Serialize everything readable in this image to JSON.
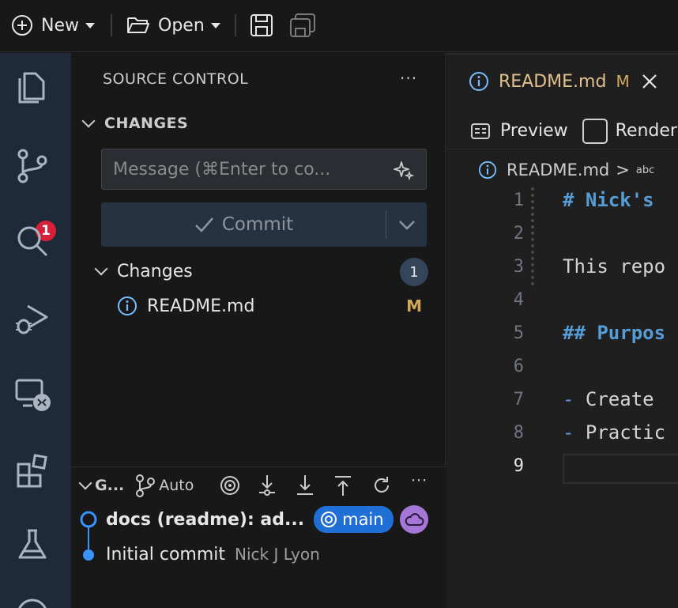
{
  "toolbar": {
    "new_label": "New",
    "open_label": "Open"
  },
  "activity": {
    "scm_badge": "1"
  },
  "sidebar": {
    "title": "SOURCE CONTROL",
    "more": "···",
    "section": "CHANGES",
    "message_placeholder": "Message (⌘Enter to co...",
    "commit_label": "Commit",
    "changes_group": "Changes",
    "changes_count": "1",
    "files": [
      {
        "name": "README.md",
        "status": "M"
      }
    ]
  },
  "graph": {
    "title": "G...",
    "auto_label": "Auto",
    "more": "···",
    "commits": [
      {
        "message": "docs (readme): ad...",
        "branch": "main"
      },
      {
        "message": "Initial commit",
        "author": "Nick J Lyon"
      }
    ]
  },
  "editor": {
    "tab_name": "README.md",
    "tab_status": "M",
    "preview_label": "Preview",
    "render_label": "Render",
    "breadcrumb_file": "README.md",
    "breadcrumb_sep": ">",
    "breadcrumb_symbol": "abc",
    "lines": [
      {
        "n": "1",
        "text": "# Nick's"
      },
      {
        "n": "2",
        "text": ""
      },
      {
        "n": "3",
        "text": "This repo"
      },
      {
        "n": "4",
        "text": ""
      },
      {
        "n": "5",
        "text": "## Purpos"
      },
      {
        "n": "6",
        "text": ""
      },
      {
        "n": "7",
        "text": "Create"
      },
      {
        "n": "8",
        "text": "Practic"
      },
      {
        "n": "9",
        "text": ""
      }
    ]
  },
  "colors": {
    "accent": "#1f6fd6",
    "badge": "#d6203a",
    "modified": "#d4a85a"
  }
}
